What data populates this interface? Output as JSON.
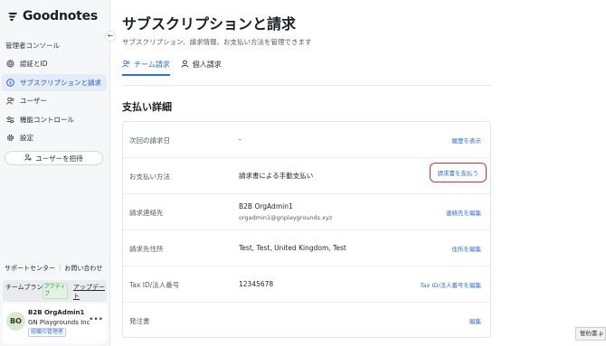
{
  "brand": {
    "name": "Goodnotes"
  },
  "sidebar": {
    "section_title": "管理者コンソール",
    "items": [
      {
        "label": "認証とID",
        "icon": "fingerprint-icon"
      },
      {
        "label": "サブスクリプションと請求",
        "icon": "dollar-circle-icon",
        "active": true
      },
      {
        "label": "ユーザー",
        "icon": "users-icon"
      },
      {
        "label": "機能コントロール",
        "icon": "toggle-icon"
      },
      {
        "label": "設定",
        "icon": "gear-icon"
      }
    ],
    "invite_label": "ユーザーを招待",
    "support_label": "サポートセンター",
    "contact_label": "お問い合わせ",
    "plan": {
      "label": "チームプラン",
      "badge": "アクティブ",
      "update_label": "アップデート"
    },
    "profile": {
      "initials": "BO",
      "name": "B2B OrgAdmin1",
      "org": "GN Playgrounds Inc",
      "role": "組織の管理者"
    }
  },
  "header": {
    "title": "サブスクリプションと請求",
    "subtitle": "サブスクリプション、請求情報、お支払い方法を管理できます"
  },
  "tabs": [
    {
      "label": "チーム請求",
      "icon": "team-icon",
      "active": true
    },
    {
      "label": "個人請求",
      "icon": "person-icon",
      "active": false
    }
  ],
  "payment": {
    "title": "支払い詳細",
    "rows": [
      {
        "label": "次回の請求日",
        "value": "-",
        "action": "履歴を表示"
      },
      {
        "label": "お支払い方法",
        "value": "請求書による手動支払い",
        "action": "請求書を支払う",
        "highlighted": true
      },
      {
        "label": "請求連絡先",
        "value": "B2B OrgAdmin1",
        "value2": "orgadmin1@gnplaygrounds.xyz",
        "action": "連絡先を編集"
      },
      {
        "label": "請求先住所",
        "value": "Test, Test, United Kingdom, Test",
        "action": "住所を編集"
      },
      {
        "label": "Tax ID/法人番号",
        "value": "12345678",
        "action": "Tax ID/法人番号を編集"
      },
      {
        "label": "発注書",
        "value": "",
        "action": "編集"
      }
    ]
  },
  "tooltip": {
    "text": "誓約書.p"
  },
  "colors": {
    "accent": "#2f6fd3",
    "highlight_border": "#d93025",
    "active_nav_bg": "#e4ecf8"
  }
}
